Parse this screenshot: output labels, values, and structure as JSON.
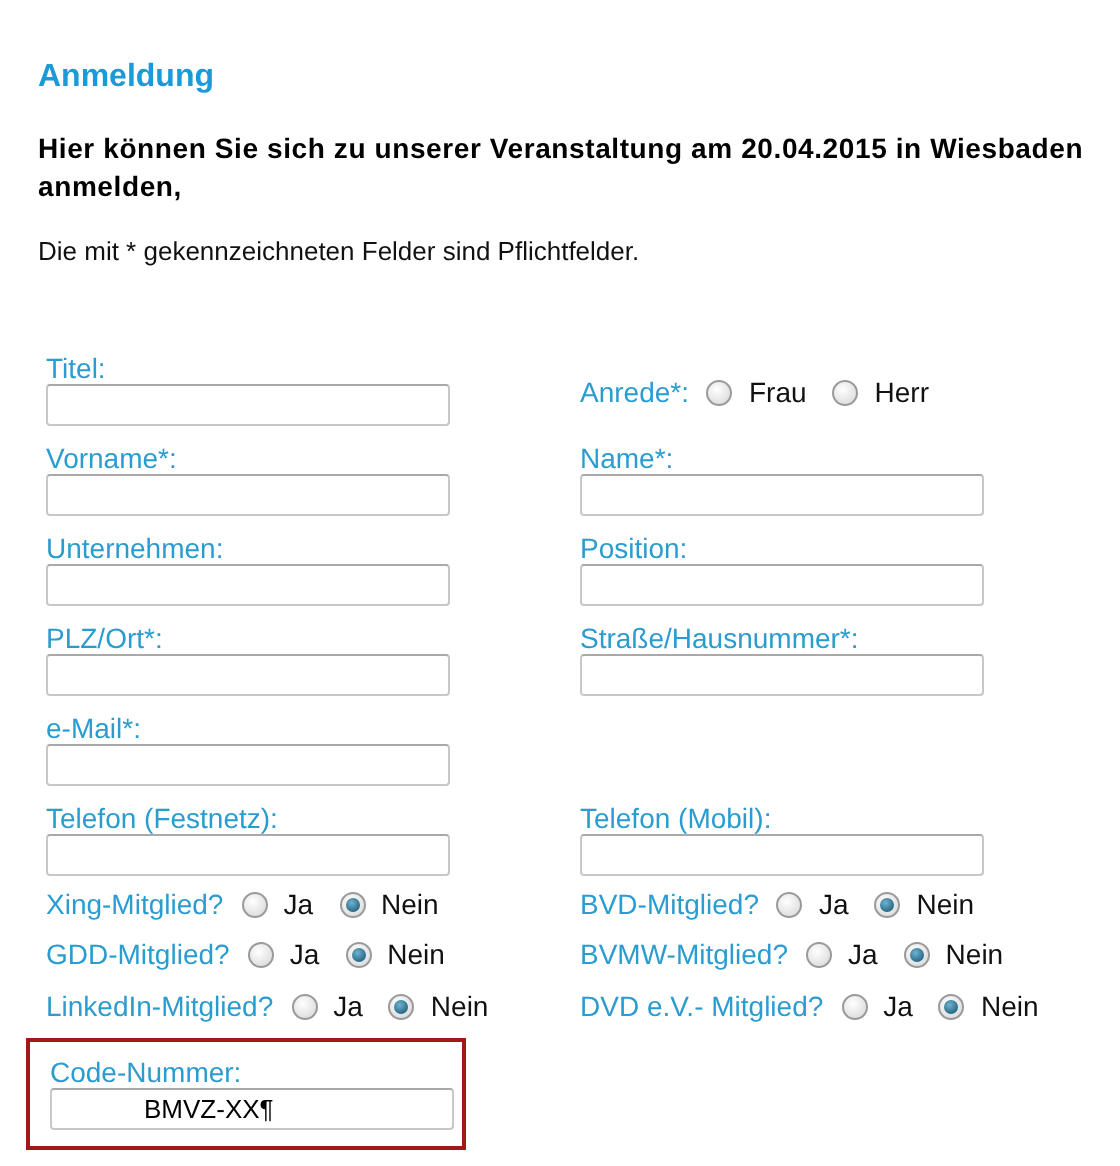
{
  "heading": "Anmeldung",
  "intro": "Hier können Sie sich zu unserer Veranstaltung am 20.04.2015 in Wiesbaden anmelden,",
  "note": "Die mit * gekennzeichneten Felder sind Pflichtfelder.",
  "field_rows": [
    {
      "left": {
        "kind": "text",
        "label": "Titel:"
      },
      "right": {
        "kind": "choice",
        "label": "Anrede*:",
        "options": [
          {
            "label": "Frau",
            "selected": false
          },
          {
            "label": "Herr",
            "selected": false
          }
        ]
      }
    },
    {
      "left": {
        "kind": "text",
        "label": "Vorname*:"
      },
      "right": {
        "kind": "text",
        "label": "Name*:"
      }
    },
    {
      "left": {
        "kind": "text",
        "label": "Unternehmen:"
      },
      "right": {
        "kind": "text",
        "label": "Position:"
      }
    },
    {
      "left": {
        "kind": "text",
        "label": "PLZ/Ort*:"
      },
      "right": {
        "kind": "text",
        "label": "Straße/Hausnummer*:"
      }
    },
    {
      "left": {
        "kind": "text",
        "label": "e-Mail*:"
      }
    },
    {
      "left": {
        "kind": "text",
        "label": "Telefon (Festnetz):"
      },
      "right": {
        "kind": "text",
        "label": "Telefon (Mobil):"
      }
    }
  ],
  "member_rows": [
    {
      "left": {
        "kind": "choice",
        "label": "Xing-Mitglied?",
        "options": [
          {
            "label": "Ja",
            "selected": false
          },
          {
            "label": "Nein",
            "selected": true
          }
        ]
      },
      "right": {
        "kind": "choice",
        "label": "BVD-Mitglied?",
        "options": [
          {
            "label": "Ja",
            "selected": false
          },
          {
            "label": "Nein",
            "selected": true
          }
        ]
      }
    },
    {
      "left": {
        "kind": "choice",
        "label": "GDD-Mitglied?",
        "options": [
          {
            "label": "Ja",
            "selected": false
          },
          {
            "label": "Nein",
            "selected": true
          }
        ]
      },
      "right": {
        "kind": "choice",
        "label": "BVMW-Mitglied?",
        "options": [
          {
            "label": "Ja",
            "selected": false
          },
          {
            "label": "Nein",
            "selected": true
          }
        ]
      }
    },
    {
      "left": {
        "kind": "choice",
        "label": "LinkedIn-Mitglied?",
        "options": [
          {
            "label": "Ja",
            "selected": false
          },
          {
            "label": "Nein",
            "selected": true
          }
        ]
      },
      "right": {
        "kind": "choice",
        "label": "DVD e.V.- Mitglied?",
        "options": [
          {
            "label": "Ja",
            "selected": false
          },
          {
            "label": "Nein",
            "selected": true
          }
        ]
      }
    }
  ],
  "code_field": {
    "label": "Code-Nummer:",
    "value": "BMVZ-XX¶",
    "highlighted": true
  }
}
